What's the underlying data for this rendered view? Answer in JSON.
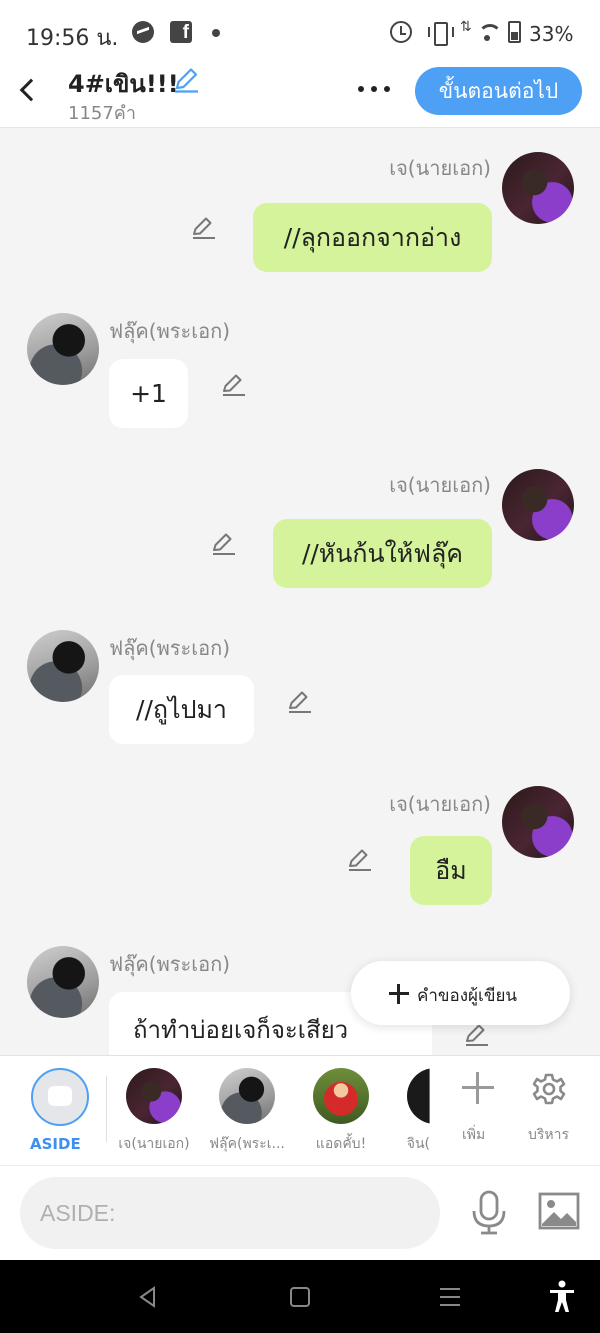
{
  "status_bar": {
    "time": "19:56 น.",
    "battery": "33%",
    "data_arrows": "⇅"
  },
  "header": {
    "title": "4#เขิน!!!",
    "word_count": "1157คำ",
    "next_button": "ขั้นตอนต่อไป"
  },
  "messages": [
    {
      "speaker": "เจ(นายเอก)",
      "side": "right",
      "text": "//ลุกออกจากอ่าง"
    },
    {
      "speaker": "ฟลุ๊ค(พระเอก)",
      "side": "left",
      "text": "+1"
    },
    {
      "speaker": "เจ(นายเอก)",
      "side": "right",
      "text": "//หันก้นให้ฟลุ๊ค"
    },
    {
      "speaker": "ฟลุ๊ค(พระเอก)",
      "side": "left",
      "text": "//ถูไปมา"
    },
    {
      "speaker": "เจ(นายเอก)",
      "side": "right",
      "text": "อืม"
    },
    {
      "speaker": "ฟลุ๊ค(พระเอก)",
      "side": "left",
      "text": "ถ้าทำบ่อยเจก็จะเสียว"
    }
  ],
  "author_button": {
    "label": "คำของผู้เขียน"
  },
  "character_bar": {
    "aside_label": "ASIDE",
    "characters": [
      "เจ(นายเอก)",
      "ฟลุ๊ค(พระเ...",
      "แอดคั้บ!",
      "จิน("
    ],
    "add_label": "เพิ่ม",
    "manage_label": "บริหาร"
  },
  "composer": {
    "placeholder": "ASIDE:"
  },
  "colors": {
    "accent": "#4da0f4",
    "own_bubble": "#d5f39a",
    "other_bubble": "#ffffff"
  }
}
